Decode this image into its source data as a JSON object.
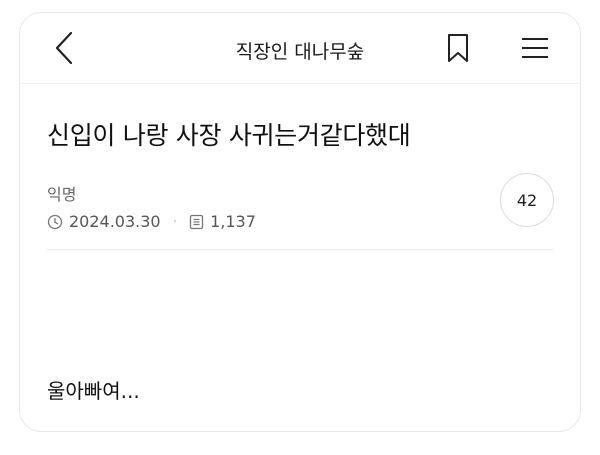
{
  "header": {
    "title": "직장인 대나무숲",
    "icons": {
      "back": "chevron-left-icon",
      "bookmark": "bookmark-icon",
      "menu": "menu-icon"
    }
  },
  "post": {
    "title": "신입이 나랑 사장 사귀는거같다했대",
    "author": "익명",
    "date": "2024.03.30",
    "views": "1,137",
    "comment_count": "42",
    "body": "울아빠여..."
  },
  "colors": {
    "text": "#111111",
    "meta": "#555555",
    "border": "#e7e7e7"
  }
}
